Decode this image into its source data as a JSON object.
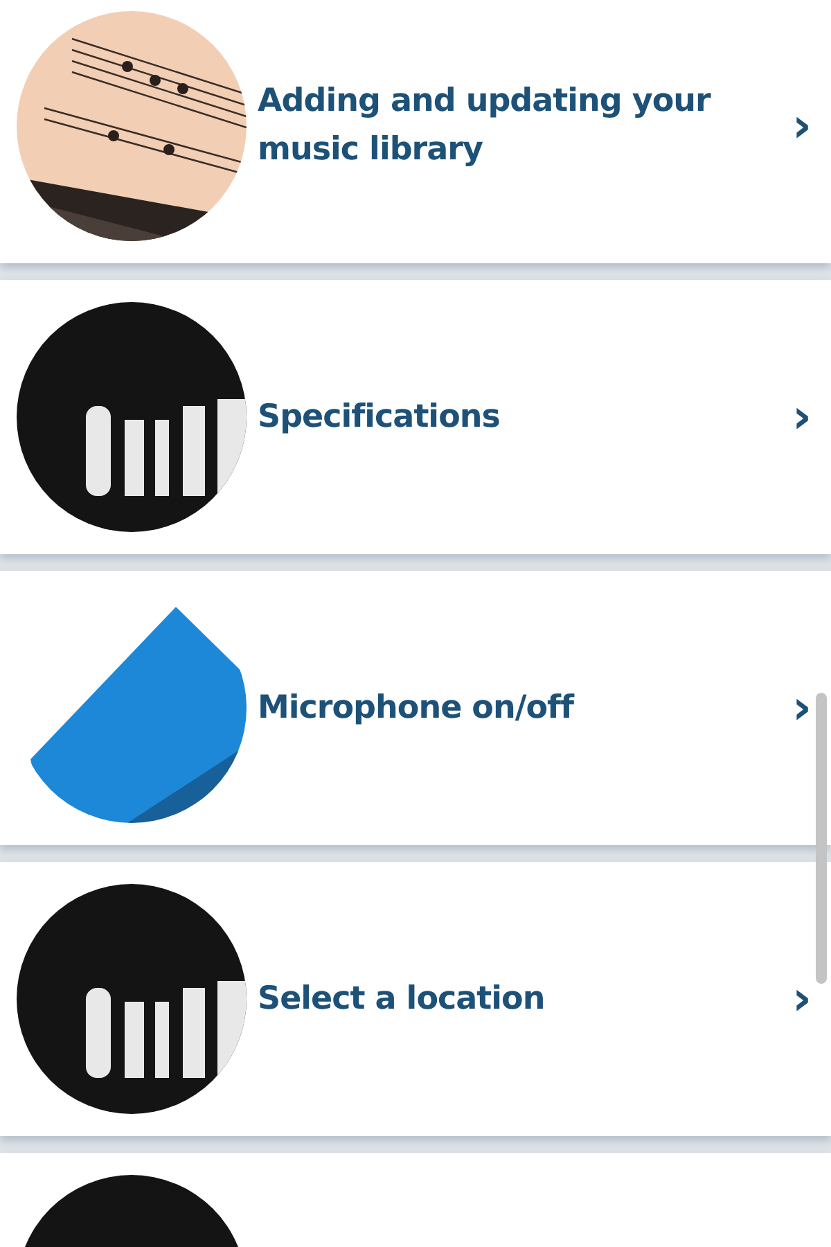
{
  "items": [
    {
      "kind": "picture",
      "title": "Adding and updating your music library",
      "chevron": "›"
    },
    {
      "kind": "picture",
      "title": "Specifications",
      "chevron": "›"
    },
    {
      "kind": "picture",
      "title": "Microphone on/off",
      "chevron": "›"
    },
    {
      "kind": "picture",
      "title": "Select a location",
      "chevron": "›"
    },
    {
      "kind": "picture"
    }
  ]
}
